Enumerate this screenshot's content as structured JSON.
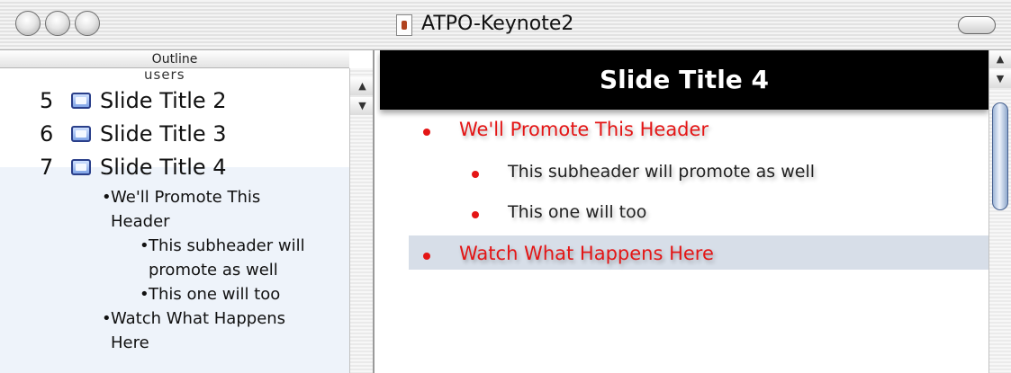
{
  "window": {
    "title": "ATPO-Keynote2"
  },
  "outline": {
    "header": "Outline",
    "partial_row_text": "users",
    "slides": [
      {
        "number": "5",
        "label": "Slide Title 2"
      },
      {
        "number": "6",
        "label": "Slide Title 3"
      },
      {
        "number": "7",
        "label": "Slide Title 4"
      }
    ],
    "topics": [
      {
        "bullet": "•",
        "text": "We'll Promote This",
        "level": 1
      },
      {
        "bullet": "",
        "text": "Header",
        "level": 1
      },
      {
        "bullet": "•",
        "text": "This subheader will",
        "level": 2
      },
      {
        "bullet": "",
        "text": "promote as well",
        "level": 2
      },
      {
        "bullet": "•",
        "text": "This one will too",
        "level": 2
      },
      {
        "bullet": "•",
        "text": "Watch What Happens",
        "level": 1
      },
      {
        "bullet": "",
        "text": "Here",
        "level": 1
      }
    ]
  },
  "slide": {
    "title": "Slide Title 4",
    "bullets": [
      {
        "text": "We'll Promote This Header",
        "level": 1
      },
      {
        "text": "This subheader will promote as well",
        "level": 2
      },
      {
        "text": "This one will too",
        "level": 2
      },
      {
        "text": "Watch What Happens Here",
        "level": 1,
        "highlighted": true
      }
    ]
  },
  "colors": {
    "bullet_red": "#e41515",
    "title_band": "#000000",
    "selection_bg": "#eef3fa",
    "highlight_row": "#d7dee8"
  },
  "icons": {
    "window_controls": [
      "close-icon",
      "minimize-icon",
      "zoom-icon"
    ],
    "document_icon": "keynote-document-icon",
    "slide_icon": "slide-thumbnail-icon",
    "scroll_up": "▲",
    "scroll_down": "▼"
  }
}
